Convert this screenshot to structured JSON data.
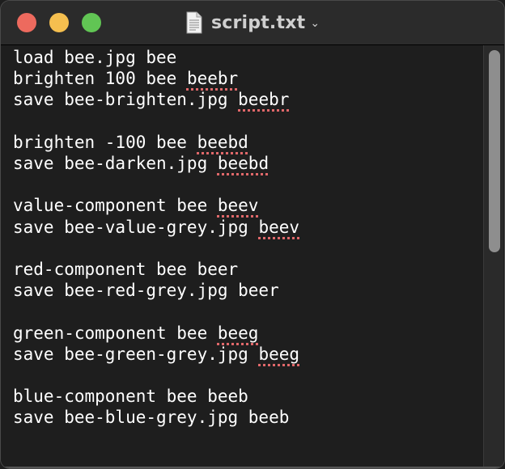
{
  "window": {
    "title": "script.txt",
    "title_chevron": "⌄",
    "file_icon": "document-icon",
    "traffic_lights": {
      "close": "#ed6a5e",
      "minimize": "#f5bf4f",
      "maximize": "#61c554"
    }
  },
  "editor": {
    "text_color": "#ffffff",
    "background": "#1e1e1e",
    "spellcheck_color": "#e0686a",
    "lines": [
      {
        "before": "load bee.jpg bee",
        "flag": "",
        "after": ""
      },
      {
        "before": "brighten 100 bee ",
        "flag": "beebr",
        "after": ""
      },
      {
        "before": "save bee-brighten.jpg ",
        "flag": "beebr",
        "after": ""
      },
      {
        "before": "",
        "flag": "",
        "after": ""
      },
      {
        "before": "brighten -100 bee ",
        "flag": "beebd",
        "after": ""
      },
      {
        "before": "save bee-darken.jpg ",
        "flag": "beebd",
        "after": ""
      },
      {
        "before": "",
        "flag": "",
        "after": ""
      },
      {
        "before": "value-component bee ",
        "flag": "beev",
        "after": ""
      },
      {
        "before": "save bee-value-grey.jpg ",
        "flag": "beev",
        "after": ""
      },
      {
        "before": "",
        "flag": "",
        "after": ""
      },
      {
        "before": "red-component bee beer",
        "flag": "",
        "after": ""
      },
      {
        "before": "save bee-red-grey.jpg beer",
        "flag": "",
        "after": ""
      },
      {
        "before": "",
        "flag": "",
        "after": ""
      },
      {
        "before": "green-component bee ",
        "flag": "beeg",
        "after": ""
      },
      {
        "before": "save bee-green-grey.jpg ",
        "flag": "beeg",
        "after": ""
      },
      {
        "before": "",
        "flag": "",
        "after": ""
      },
      {
        "before": "blue-component bee beeb",
        "flag": "",
        "after": ""
      },
      {
        "before": "save bee-blue-grey.jpg beeb",
        "flag": "",
        "after": ""
      }
    ]
  }
}
